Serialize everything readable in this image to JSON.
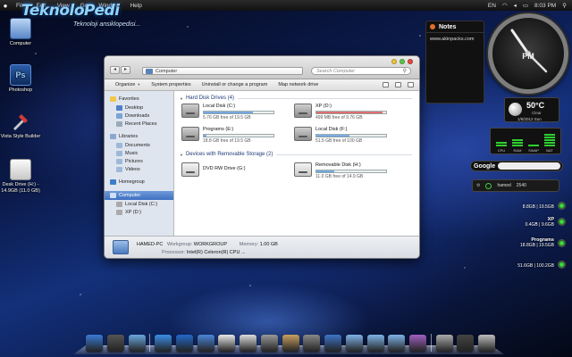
{
  "menubar": {
    "items": [
      "File",
      "Edit",
      "View",
      "Go",
      "Window",
      "Help"
    ],
    "language": "EN",
    "clock": "8:03 PM"
  },
  "watermark": {
    "title": "TeknoloPedi",
    "subtitle": "Teknoloji ansiklopedisi..."
  },
  "desktop_icons": [
    {
      "label": "Computer"
    },
    {
      "label": "Photoshop",
      "glyph": "Ps"
    },
    {
      "label": "Vista Style Builder"
    },
    {
      "label": "Desk Drive (H:) - 14.9GB (11.0 GB)"
    }
  ],
  "window": {
    "address": "Computer",
    "search_placeholder": "Search Computer",
    "toolbar": [
      "Organize",
      "System properties",
      "Uninstall or change a program",
      "Map network drive"
    ],
    "sidebar": {
      "favorites": {
        "title": "Favorites",
        "items": [
          "Desktop",
          "Downloads",
          "Recent Places"
        ]
      },
      "libraries": {
        "title": "Libraries",
        "items": [
          "Documents",
          "Music",
          "Pictures",
          "Videos"
        ]
      },
      "homegroup": "Homegroup",
      "computer": {
        "title": "Computer",
        "items": [
          "Local Disk (C:)",
          "XP (D:)"
        ]
      }
    },
    "hard_disks": {
      "title": "Hard Disk Drives (4)",
      "drives": [
        {
          "name": "Local Disk (C:)",
          "free": "5.76 GB free of 19.5 GB",
          "used_fraction": 0.7,
          "color": "blue"
        },
        {
          "name": "XP (D:)",
          "free": "499 MB free of 9.76 GB",
          "used_fraction": 0.95,
          "color": "red"
        },
        {
          "name": "Programs (E:)",
          "free": "18.8 GB free of 19.5 GB",
          "used_fraction": 0.04,
          "color": "blue"
        },
        {
          "name": "Local Disk (F:)",
          "free": "51.5 GB free of 100 GB",
          "used_fraction": 0.48,
          "color": "blue"
        }
      ]
    },
    "removable": {
      "title": "Devices with Removable Storage (2)",
      "drives": [
        {
          "name": "DVD RW Drive (G:)"
        },
        {
          "name": "Removable Disk (H:)",
          "free": "11.0 GB free of 14.9 GB",
          "used_fraction": 0.26,
          "color": "blue"
        }
      ]
    },
    "details": {
      "computer_name": "HAMED-PC",
      "workgroup_label": "Workgroup:",
      "workgroup": "WORKGROUP",
      "memory_label": "Memory:",
      "memory": "1.00 GB",
      "processor_label": "Processor:",
      "processor": "Intel(R) Celeron(R) CPU ..."
    }
  },
  "widgets": {
    "notes": {
      "title": "Notes",
      "text": "www.akinpacks.com"
    },
    "clock": {
      "period": "PM"
    },
    "weather": {
      "temp": "50°C",
      "condition": "Clear",
      "date": "1/8/2012 Sun"
    },
    "meters": {
      "labels": [
        "CPU",
        "RAM",
        "SWAP",
        "BAT"
      ],
      "levels": [
        0.35,
        0.55,
        0.2,
        0.75
      ]
    },
    "google": {
      "logo": "Google"
    },
    "drive_widget": {
      "name": "hamed",
      "value": "2540"
    },
    "disks": [
      {
        "name": "",
        "value": "8.8GB | 19.5GB"
      },
      {
        "name": "XP",
        "value": "0.4GB | 9.6GB"
      },
      {
        "name": "Programs",
        "value": "18.8GB | 19.5GB"
      },
      {
        "name": "",
        "value": "51.6GB | 100.2GB"
      }
    ]
  },
  "dock": {
    "icons": [
      "finder-icon",
      "photo-icon",
      "folder-icon",
      "safari-icon",
      "quicktime-icon",
      "mail-icon",
      "preview-icon",
      "textedit-icon",
      "calculator-icon",
      "iphoto-icon",
      "automator-icon",
      "itunes-icon",
      "applications-folder-icon",
      "documents-folder-icon",
      "downloads-folder-icon",
      "photo-booth-icon",
      "utilities-icon",
      "shutdown-icon",
      "trash-icon"
    ],
    "colors": [
      "#3a7bd5",
      "#555",
      "#6aa6e0",
      "#3b8ee8",
      "#2468c9",
      "#4a86d8",
      "#e8e8e8",
      "#ddd",
      "#999",
      "#c8a060",
      "#888",
      "#3d74c8",
      "#7fb2e6",
      "#7fb2e6",
      "#7fb2e6",
      "#a060c0",
      "#aaa",
      "#444",
      "#bbb"
    ]
  }
}
